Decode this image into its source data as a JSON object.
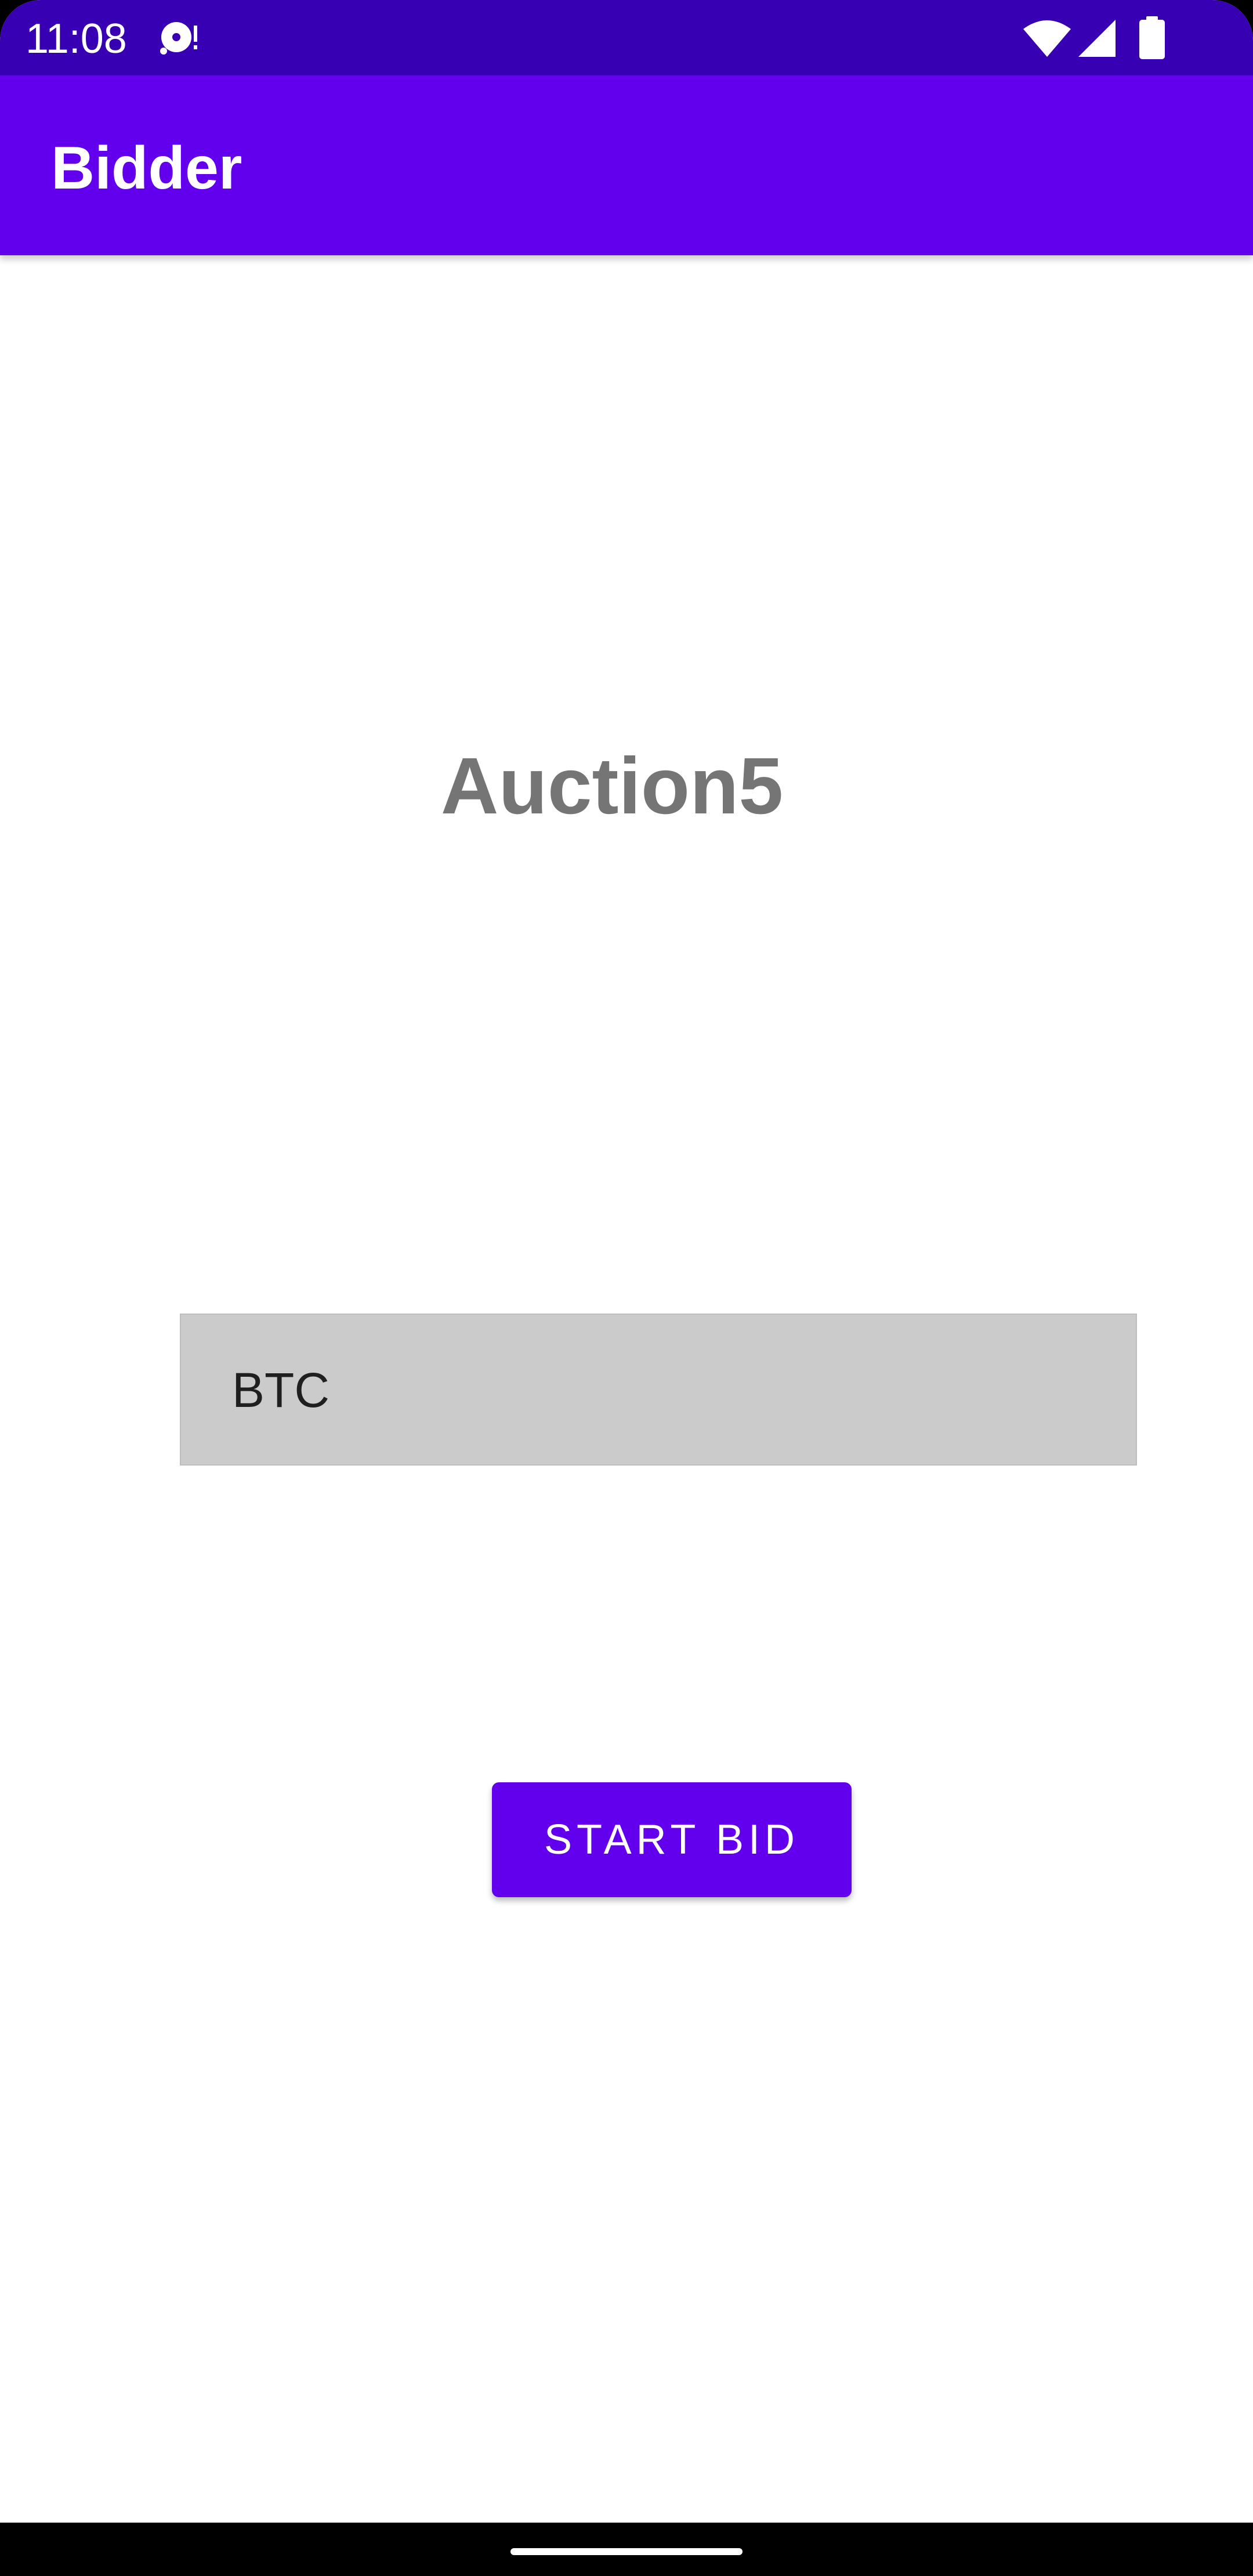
{
  "status_bar": {
    "time": "11:08",
    "icons": [
      "notification-disc-icon",
      "wifi-icon",
      "cell-signal-icon",
      "battery-icon"
    ],
    "background_color": "#3700b3"
  },
  "app_bar": {
    "title": "Bidder",
    "background_color": "#6200ee"
  },
  "main": {
    "auction_title": "Auction5",
    "currency_field": {
      "value": "BTC"
    },
    "start_bid_button": {
      "label": "START BID"
    }
  },
  "navigation": {
    "home_handle_icon": "home-gesture-handle"
  }
}
